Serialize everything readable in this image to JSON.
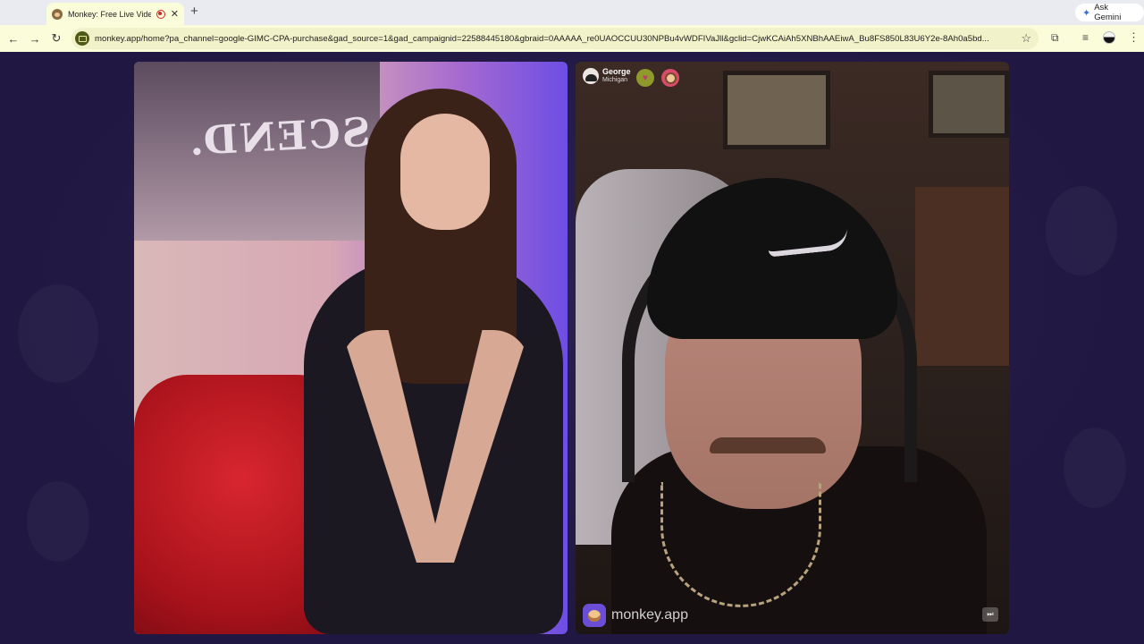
{
  "browser": {
    "tab": {
      "title": "Monkey: Free Live Video"
    },
    "new_tab_icon": "plus-icon",
    "gemini_button": "Ask Gemini",
    "url": "monkey.app/home?pa_channel=google-GIMC-CPA-purchase&gad_source=1&gad_campaignid=22588445180&gbraid=0AAAAA_re0UAOCCUU30NPBu4vWDFIVaJll&gclid=CjwKCAiAh5XNBhAAEiwA_Bu8FS850L83U6Y2e-8Ah0a5bd...",
    "icons": [
      "back-arrow-icon",
      "forward-arrow-icon",
      "reload-icon",
      "bookmark-star-icon",
      "google-lens-icon",
      "media-controls-icon",
      "profile-avatar",
      "more-menu-icon"
    ]
  },
  "call": {
    "remote_user": {
      "name": "George",
      "location": "Michigan",
      "badges": [
        "heart-badge",
        "monkey-badge"
      ]
    },
    "watermark": "monkey.app",
    "skip_icon": "skip-next-icon"
  },
  "colors": {
    "page_background": "#231a44",
    "chrome_toolbar": "#fbfcd9",
    "brand_purple": "#6a4fd6"
  }
}
